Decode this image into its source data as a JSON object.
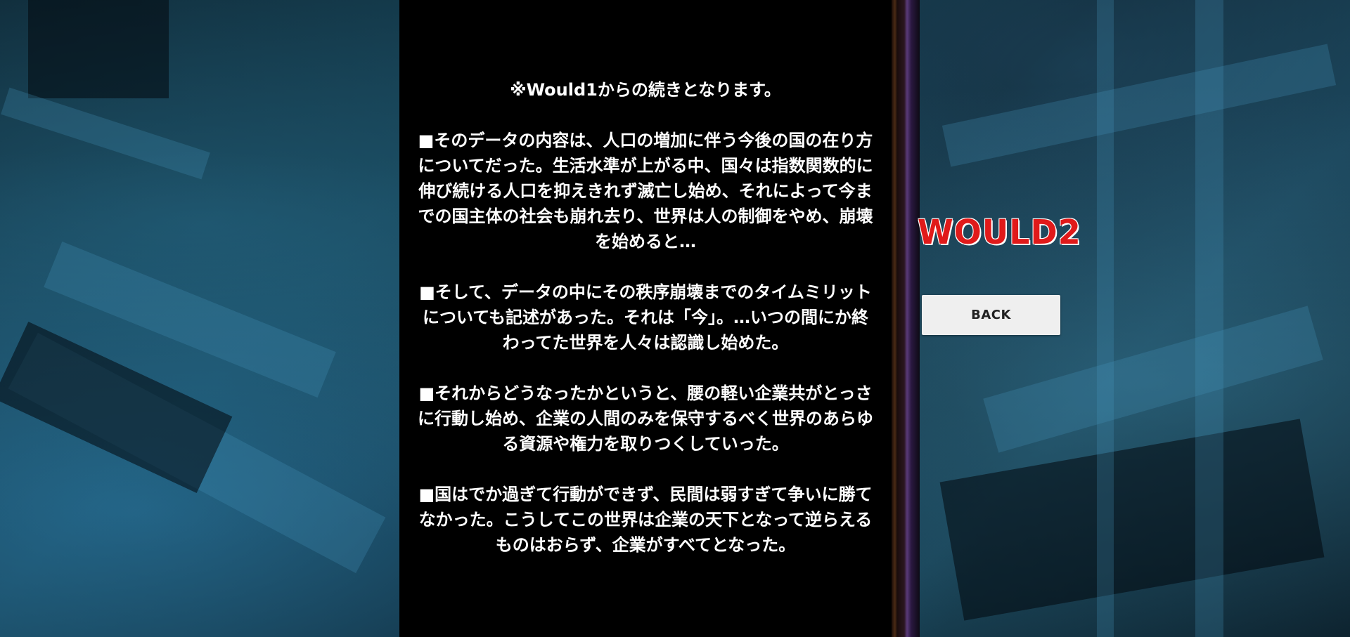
{
  "page": {
    "title": "WOULD2"
  },
  "story": {
    "paragraphs": [
      "※Would1からの続きとなります。",
      "■そのデータの内容は、人口の増加に伴う今後の国の在り方についてだった。生活水準が上がる中、国々は指数関数的に伸び続ける人口を抑えきれず滅亡し始め、それによって今までの国主体の社会も崩れ去り、世界は人の制御をやめ、崩壊を始めると…",
      "■そして、データの中にその秩序崩壊までのタイムミリットについても記述があった。それは「今」。…いつの間にか終わってた世界を人々は認識し始めた。",
      "■それからどうなったかというと、腰の軽い企業共がとっさに行動し始め、企業の人間のみを保守するべく世界のあらゆる資源や権力を取りつくしていった。",
      "■国はでか過ぎて行動ができず、民間は弱すぎて争いに勝てなかった。こうしてこの世界は企業の天下となって逆らえるものはおらず、企業がすべてとなった。"
    ]
  },
  "nav": {
    "back_label": "BACK"
  },
  "colors": {
    "panel": "#000000",
    "title": "#e01a1a",
    "button_bg": "#efefef"
  }
}
